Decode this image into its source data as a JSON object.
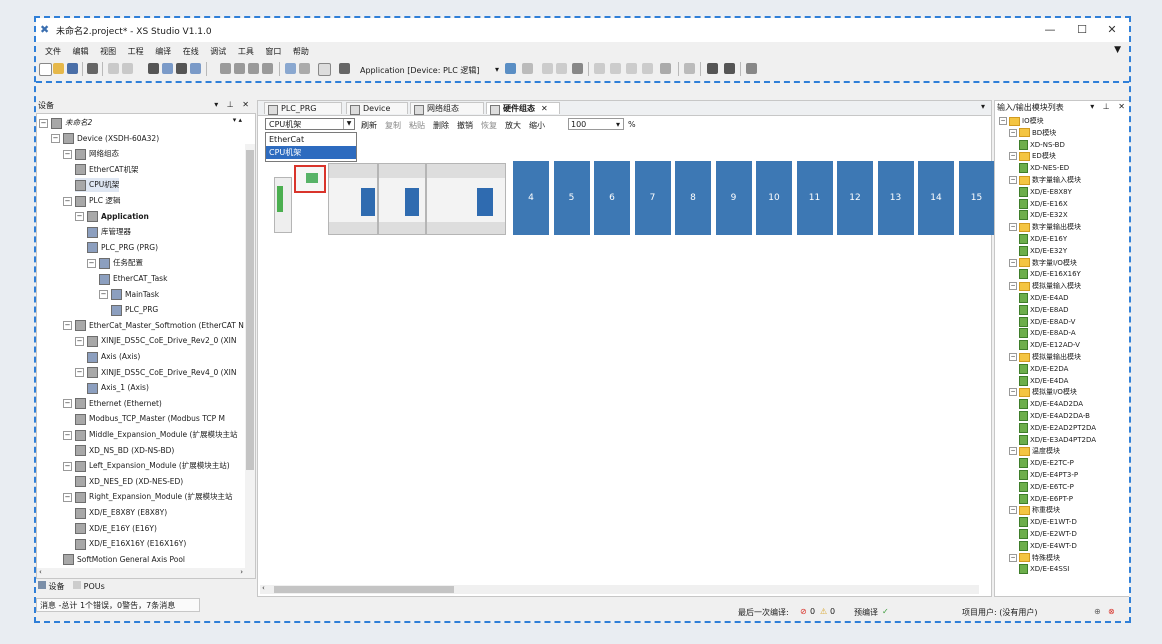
{
  "window": {
    "title": "未命名2.project* - XS Studio V1.1.0",
    "min": "—",
    "max": "☐",
    "close": "✕"
  },
  "menu": [
    "文件",
    "编辑",
    "视图",
    "工程",
    "编译",
    "在线",
    "调试",
    "工具",
    "窗口",
    "帮助"
  ],
  "toolbar": {
    "application_label": "Application [Device: PLC 逻辑]"
  },
  "left_panel": {
    "title": "设备",
    "tree": [
      {
        "label": "未命名2",
        "indent": 0,
        "italic": true
      },
      {
        "label": "Device (XSDH-60A32)",
        "indent": 1
      },
      {
        "label": "网络组态",
        "indent": 2
      },
      {
        "label": "EtherCAT机架",
        "indent": 3
      },
      {
        "label": "CPU机架",
        "indent": 3,
        "selected": true
      },
      {
        "label": "PLC 逻辑",
        "indent": 2
      },
      {
        "label": "Application",
        "indent": 3,
        "bold": true
      },
      {
        "label": "库管理器",
        "indent": 4
      },
      {
        "label": "PLC_PRG (PRG)",
        "indent": 4
      },
      {
        "label": "任务配置",
        "indent": 4
      },
      {
        "label": "EtherCAT_Task",
        "indent": 5
      },
      {
        "label": "MainTask",
        "indent": 5
      },
      {
        "label": "PLC_PRG",
        "indent": 6
      },
      {
        "label": "EtherCat_Master_Softmotion (EtherCAT N",
        "indent": 2
      },
      {
        "label": "XINJE_DS5C_CoE_Drive_Rev2_0 (XIN",
        "indent": 3
      },
      {
        "label": "Axis (Axis)",
        "indent": 4
      },
      {
        "label": "XINJE_DS5C_CoE_Drive_Rev4_0 (XIN",
        "indent": 3
      },
      {
        "label": "Axis_1 (Axis)",
        "indent": 4
      },
      {
        "label": "Ethernet (Ethernet)",
        "indent": 2
      },
      {
        "label": "Modbus_TCP_Master (Modbus TCP M",
        "indent": 3
      },
      {
        "label": "Middle_Expansion_Module (扩展模块主站",
        "indent": 2
      },
      {
        "label": "XD_NS_BD (XD-NS-BD)",
        "indent": 3
      },
      {
        "label": "Left_Expansion_Module (扩展模块主站)",
        "indent": 2
      },
      {
        "label": "XD_NES_ED (XD-NES-ED)",
        "indent": 3
      },
      {
        "label": "Right_Expansion_Module (扩展模块主站",
        "indent": 2
      },
      {
        "label": "XD/E_E8X8Y (E8X8Y)",
        "indent": 3
      },
      {
        "label": "XD/E_E16Y (E16Y)",
        "indent": 3
      },
      {
        "label": "XD/E_E16X16Y (E16X16Y)",
        "indent": 3
      },
      {
        "label": "SoftMotion General Axis Pool",
        "indent": 2
      }
    ],
    "bottom_tabs": [
      "设备",
      "POUs"
    ],
    "messages": "消息 -总计 1个错误，0警告，7条消息"
  },
  "center": {
    "tabs": [
      "PLC_PRG",
      "Device",
      "网络组态",
      "硬件组态"
    ],
    "active_tab": "硬件组态",
    "rack_combo": "CPU机架",
    "toolbar": [
      "刷新",
      "复制",
      "粘贴",
      "删除",
      "撤销",
      "恢复",
      "放大",
      "缩小"
    ],
    "zoom": "100",
    "zoom_unit": "%",
    "dropdown_options": [
      "EtherCat",
      "CPU机架"
    ],
    "slots": [
      "4",
      "5",
      "6",
      "7",
      "8",
      "9",
      "10",
      "11",
      "12",
      "13",
      "14",
      "15"
    ]
  },
  "right_panel": {
    "title": "输入/输出模块列表",
    "tree": [
      {
        "label": "IO模块",
        "t": "f",
        "i": 0
      },
      {
        "label": "BD模块",
        "t": "f",
        "i": 1
      },
      {
        "label": "XD-NS-BD",
        "t": "m",
        "i": 2
      },
      {
        "label": "ED模块",
        "t": "f",
        "i": 1
      },
      {
        "label": "XD-NES-ED",
        "t": "m",
        "i": 2
      },
      {
        "label": "数字量输入模块",
        "t": "f",
        "i": 1
      },
      {
        "label": "XD/E-E8X8Y",
        "t": "m",
        "i": 2
      },
      {
        "label": "XD/E-E16X",
        "t": "m",
        "i": 2
      },
      {
        "label": "XD/E-E32X",
        "t": "m",
        "i": 2
      },
      {
        "label": "数字量输出模块",
        "t": "f",
        "i": 1
      },
      {
        "label": "XD/E-E16Y",
        "t": "m",
        "i": 2
      },
      {
        "label": "XD/E-E32Y",
        "t": "m",
        "i": 2
      },
      {
        "label": "数字量I/O模块",
        "t": "f",
        "i": 1
      },
      {
        "label": "XD/E-E16X16Y",
        "t": "m",
        "i": 2
      },
      {
        "label": "模拟量输入模块",
        "t": "f",
        "i": 1
      },
      {
        "label": "XD/E-E4AD",
        "t": "m",
        "i": 2
      },
      {
        "label": "XD/E-E8AD",
        "t": "m",
        "i": 2
      },
      {
        "label": "XD/E-E8AD-V",
        "t": "m",
        "i": 2
      },
      {
        "label": "XD/E-E8AD-A",
        "t": "m",
        "i": 2
      },
      {
        "label": "XD/E-E12AD-V",
        "t": "m",
        "i": 2
      },
      {
        "label": "模拟量输出模块",
        "t": "f",
        "i": 1
      },
      {
        "label": "XD/E-E2DA",
        "t": "m",
        "i": 2
      },
      {
        "label": "XD/E-E4DA",
        "t": "m",
        "i": 2
      },
      {
        "label": "模拟量I/O模块",
        "t": "f",
        "i": 1
      },
      {
        "label": "XD/E-E4AD2DA",
        "t": "m",
        "i": 2
      },
      {
        "label": "XD/E-E4AD2DA-B",
        "t": "m",
        "i": 2
      },
      {
        "label": "XD/E-E2AD2PT2DA",
        "t": "m",
        "i": 2
      },
      {
        "label": "XD/E-E3AD4PT2DA",
        "t": "m",
        "i": 2
      },
      {
        "label": "温度模块",
        "t": "f",
        "i": 1
      },
      {
        "label": "XD/E-E2TC-P",
        "t": "m",
        "i": 2
      },
      {
        "label": "XD/E-E4PT3-P",
        "t": "m",
        "i": 2
      },
      {
        "label": "XD/E-E6TC-P",
        "t": "m",
        "i": 2
      },
      {
        "label": "XD/E-E6PT-P",
        "t": "m",
        "i": 2
      },
      {
        "label": "称重模块",
        "t": "f",
        "i": 1
      },
      {
        "label": "XD/E-E1WT-D",
        "t": "m",
        "i": 2
      },
      {
        "label": "XD/E-E2WT-D",
        "t": "m",
        "i": 2
      },
      {
        "label": "XD/E-E4WT-D",
        "t": "m",
        "i": 2
      },
      {
        "label": "特殊模块",
        "t": "f",
        "i": 1
      },
      {
        "label": "XD/E-E4SSI",
        "t": "m",
        "i": 2
      }
    ]
  },
  "statusbar": {
    "last_compile": "最后一次编译:",
    "errors": "0",
    "warnings": "0",
    "precompile": "预编译",
    "check": "✓",
    "project_user": "项目用户: (没有用户)"
  }
}
